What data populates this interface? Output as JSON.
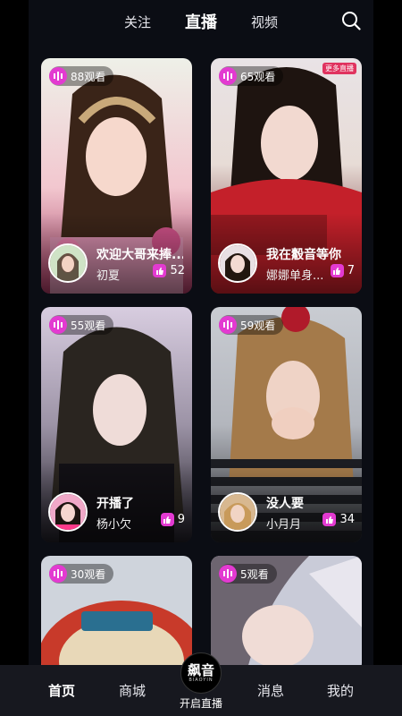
{
  "top_tabs": [
    {
      "label": "关注",
      "active": false
    },
    {
      "label": "直播",
      "active": true
    },
    {
      "label": "视频",
      "active": false
    }
  ],
  "search_icon": "search-icon",
  "accent_color": "#e33ad1",
  "cards": [
    {
      "viewers": "88观看",
      "title": "欢迎大哥来捧...",
      "host": "初夏",
      "likes": "52",
      "palette": [
        "#f2c7cf",
        "#d9a0b6",
        "#a4375f"
      ]
    },
    {
      "viewers": "65观看",
      "title": "我在觳音等你",
      "host": "娜娜单身...",
      "likes": "7",
      "palette": [
        "#e9e3e6",
        "#c4202a",
        "#5b0a10"
      ],
      "overlay_badge": "更多直播"
    },
    {
      "viewers": "55观看",
      "title": "开播了",
      "host": "杨小欠",
      "likes": "9",
      "palette": [
        "#d3c8d9",
        "#3d3a45",
        "#1e1c24"
      ]
    },
    {
      "viewers": "59观看",
      "title": "没人要",
      "host": "小月月",
      "likes": "34",
      "palette": [
        "#b8bcc4",
        "#1c1d22",
        "#dfe2e6"
      ]
    },
    {
      "viewers": "30观看",
      "title": "",
      "host": "",
      "likes": "",
      "palette": [
        "#2a6f90",
        "#c83a2a",
        "#e8d8b8"
      ]
    },
    {
      "viewers": "5观看",
      "title": "",
      "host": "",
      "likes": "",
      "palette": [
        "#c9cbd8",
        "#6d6570",
        "#f0eef2"
      ]
    }
  ],
  "bottom_nav": [
    {
      "label": "首页",
      "active": true
    },
    {
      "label": "商城",
      "active": false
    },
    {
      "label": "开启直播",
      "logo": "飙音",
      "logo_sub": "BIAOYIN"
    },
    {
      "label": "消息",
      "active": false
    },
    {
      "label": "我的",
      "active": false
    }
  ]
}
